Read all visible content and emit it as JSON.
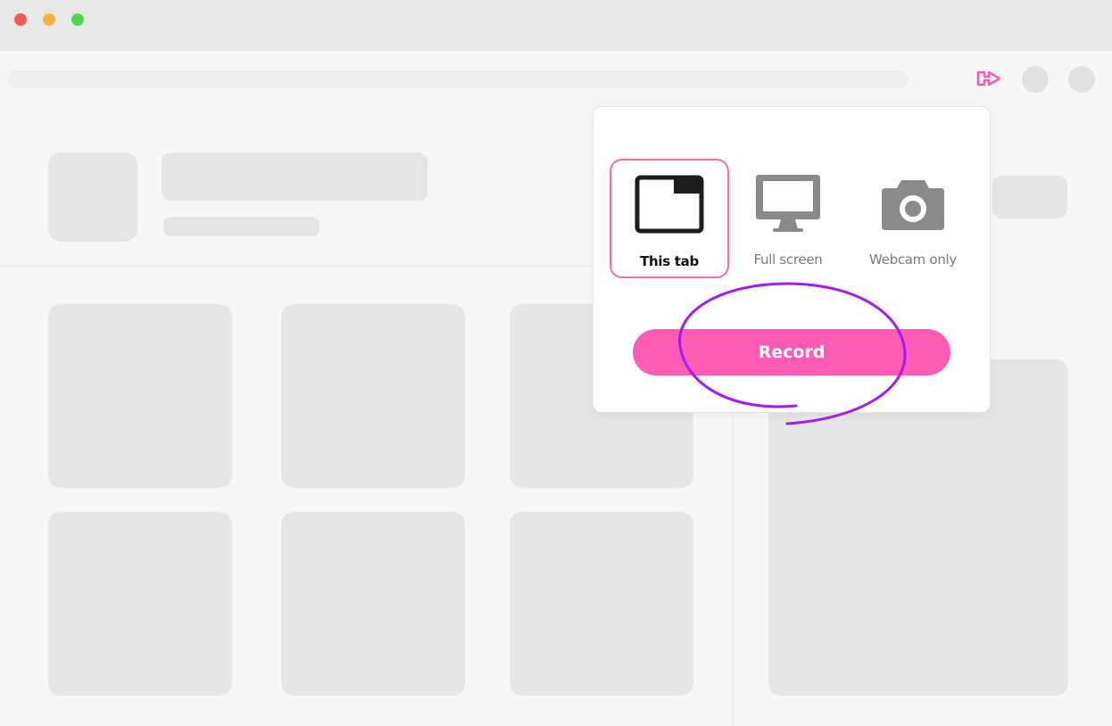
{
  "colors": {
    "accent": "#ff5cb3",
    "selected_border": "#ff6aa9",
    "annotation": "#a21cf0"
  },
  "toolbar": {
    "extension_icon": "loom-extension-icon"
  },
  "recorder": {
    "options": [
      {
        "label": "This tab",
        "icon": "browser-tab-icon",
        "selected": true
      },
      {
        "label": "Full screen",
        "icon": "monitor-icon",
        "selected": false
      },
      {
        "label": "Webcam only",
        "icon": "camera-icon",
        "selected": false
      }
    ],
    "record_label": "Record"
  }
}
